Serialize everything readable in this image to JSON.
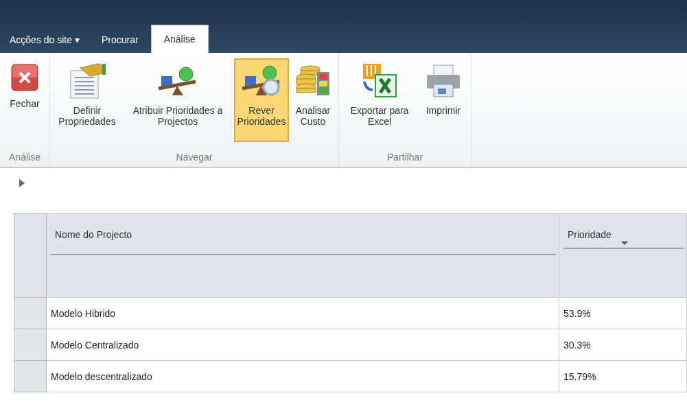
{
  "top_bar": {
    "site_actions": "Acções do site ▾"
  },
  "tabs": [
    {
      "label": "Procurar",
      "selected": false
    },
    {
      "label": "Análise",
      "selected": true
    }
  ],
  "ribbon": {
    "groups": [
      {
        "label": "Análise",
        "buttons": [
          {
            "kind": "close",
            "label": "Fechar",
            "selected": false
          }
        ]
      },
      {
        "label": "Navegar",
        "buttons": [
          {
            "kind": "properties",
            "label": "Definir Propriedades",
            "selected": false
          },
          {
            "kind": "balance",
            "label": "Atribuir Prioridades a Projectos",
            "selected": false
          },
          {
            "kind": "review",
            "label": "Rever Prioridades",
            "selected": true
          },
          {
            "kind": "coins",
            "label": "Analisar Custo",
            "selected": false
          }
        ]
      },
      {
        "label": "Partilhar",
        "buttons": [
          {
            "kind": "excel",
            "label": "Exportar para Excel",
            "selected": false
          },
          {
            "kind": "printer",
            "label": "Imprimir",
            "selected": false
          }
        ]
      }
    ]
  },
  "table": {
    "columns": [
      "Nome do Projecto",
      "Prioridade"
    ],
    "rows": [
      {
        "name": "Modelo Hibrido",
        "priority": "53.9%"
      },
      {
        "name": "Modelo Centralizado",
        "priority": "30.3%"
      },
      {
        "name": "Modelo descentralizado",
        "priority": "15.79%"
      }
    ]
  }
}
